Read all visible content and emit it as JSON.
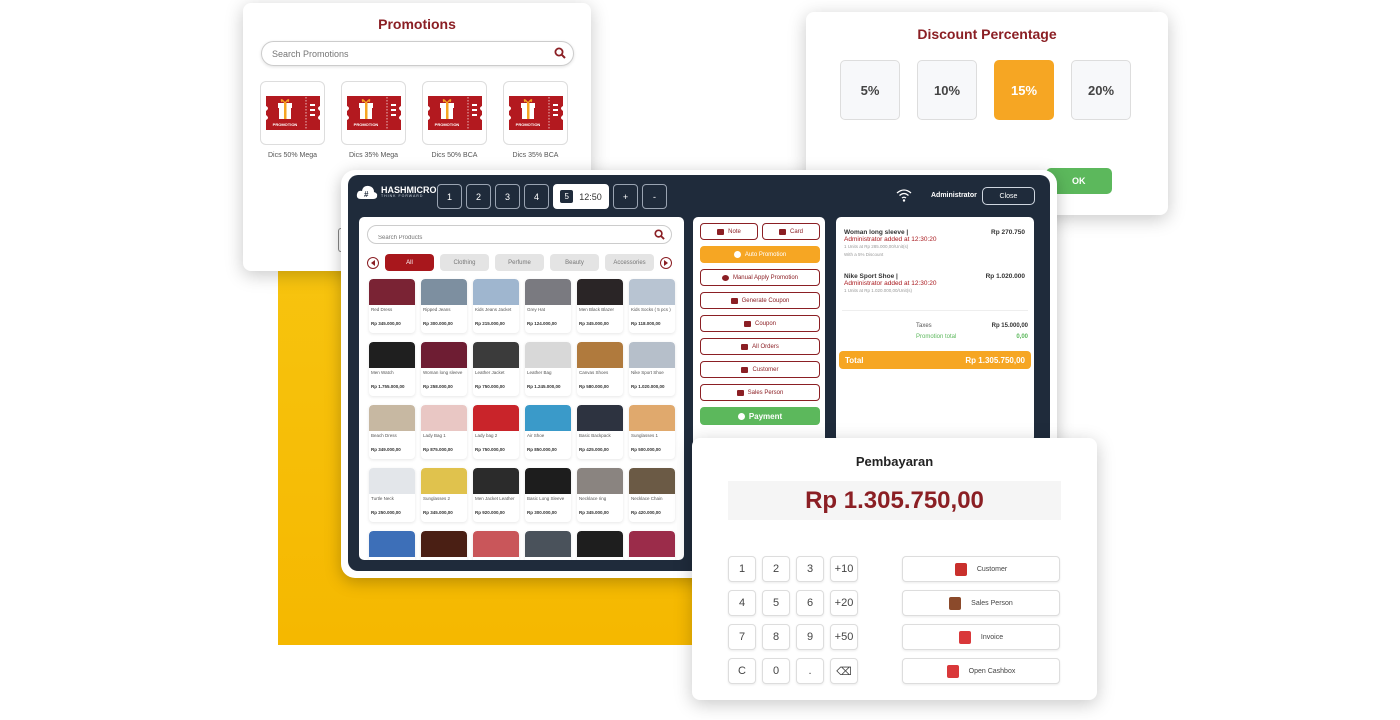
{
  "promotions": {
    "title": "Promotions",
    "search_placeholder": "Search Promotions",
    "items": [
      {
        "label": "Dics 50% Mega",
        "badge": "PROMOTION"
      },
      {
        "label": "Dics 35% Mega",
        "badge": "PROMOTION"
      },
      {
        "label": "Dics 50% BCA",
        "badge": "PROMOTION"
      },
      {
        "label": "Dics 35% BCA",
        "badge": "PROMOTION"
      }
    ]
  },
  "discount": {
    "title": "Discount Percentage",
    "options": [
      "5%",
      "10%",
      "15%",
      "20%"
    ],
    "selected": "15%",
    "ok_label": "OK"
  },
  "pos": {
    "brand": "HASHMICRO",
    "brand_tagline": "THINK FORWARD",
    "tabs": [
      "1",
      "2",
      "3",
      "4"
    ],
    "active_tab": {
      "number": "5",
      "time": "12:50"
    },
    "add_tab": "+",
    "remove_tab": "-",
    "user": "Administrator",
    "close_label": "Close",
    "search_placeholder": "Search Products",
    "categories": [
      "All",
      "Clothing",
      "Perfume",
      "Beauty",
      "Accessories"
    ],
    "active_category": "All",
    "products": [
      {
        "name": "Red Dress",
        "price": "Rp 345.000,00",
        "color": "#7a2334"
      },
      {
        "name": "Ripped Jeans",
        "price": "Rp 300.000,00",
        "color": "#7d8fa0"
      },
      {
        "name": "Kids Jeans Jacket",
        "price": "Rp 215.000,00",
        "color": "#9fb6cf"
      },
      {
        "name": "Grey Hat",
        "price": "Rp 124.000,00",
        "color": "#7a7a80"
      },
      {
        "name": "Men Black Blazer",
        "price": "Rp 345.000,00",
        "color": "#2a2526"
      },
      {
        "name": "Kids Socks ( 5 pcs )",
        "price": "Rp 118.000,00",
        "color": "#b8c4d2"
      },
      {
        "name": "Men Watch",
        "price": "Rp 1.755.000,00",
        "color": "#1f1f1f"
      },
      {
        "name": "Woman long sleeve",
        "price": "Rp 258.000,00",
        "color": "#6e1d33"
      },
      {
        "name": "Leather Jacket",
        "price": "Rp 750.000,00",
        "color": "#3b3b3b"
      },
      {
        "name": "Leather Bag",
        "price": "Rp 1.245.000,00",
        "color": "#d8d8d8"
      },
      {
        "name": "Canvas Shoes",
        "price": "Rp 580.000,00",
        "color": "#b07a3d"
      },
      {
        "name": "Nike Sport Shoe",
        "price": "Rp 1.020.000,00",
        "color": "#b6bfca"
      },
      {
        "name": "Beach Dress",
        "price": "Rp 349.000,00",
        "color": "#c7b8a2"
      },
      {
        "name": "Lady Bag 1",
        "price": "Rp 875.000,00",
        "color": "#e9c7c4"
      },
      {
        "name": "Lady bag 2",
        "price": "Rp 750.000,00",
        "color": "#c9242a"
      },
      {
        "name": "Air Shoe",
        "price": "Rp 850.000,00",
        "color": "#3a9ac9"
      },
      {
        "name": "Basic Backpack",
        "price": "Rp 425.000,00",
        "color": "#2d3340"
      },
      {
        "name": "Sunglasses 1",
        "price": "Rp 500.000,00",
        "color": "#e0a96d"
      },
      {
        "name": "Turtle Neck",
        "price": "Rp 250.000,00",
        "color": "#e3e6ea"
      },
      {
        "name": "Sunglasses 2",
        "price": "Rp 345.000,00",
        "color": "#e0c24d"
      },
      {
        "name": "Men Jacket Leather",
        "price": "Rp 920.000,00",
        "color": "#2b2b2b"
      },
      {
        "name": "Basic Long Sleeve",
        "price": "Rp 300.000,00",
        "color": "#1d1d1d"
      },
      {
        "name": "Necklace ring",
        "price": "Rp 345.000,00",
        "color": "#8a8480"
      },
      {
        "name": "Necklace Chain",
        "price": "Rp 420.000,00",
        "color": "#6b5a45"
      },
      {
        "name": "",
        "price": "",
        "color": "#3d6fb8"
      },
      {
        "name": "",
        "price": "",
        "color": "#4a1f14"
      },
      {
        "name": "",
        "price": "",
        "color": "#c9565a"
      },
      {
        "name": "",
        "price": "",
        "color": "#4a525b"
      },
      {
        "name": "",
        "price": "",
        "color": "#1e1e1e"
      },
      {
        "name": "",
        "price": "",
        "color": "#9b2c4a"
      }
    ],
    "actions": {
      "note": "Note",
      "card": "Card",
      "auto_promotion": "Auto Promotion",
      "manual_promotion": "Manual Apply Promotion",
      "generate_coupon": "Generate Coupon",
      "coupon": "Coupon",
      "all_orders": "All Orders",
      "customer": "Customer",
      "sales_person": "Sales Person",
      "payment": "Payment"
    },
    "order_lines": [
      {
        "name": "Woman long sleeve |",
        "amount": "Rp 270.750",
        "added_by": "Administrator added at 12:30:20",
        "detail": "1 Units at Rp 285.000,00/Unit(s)",
        "note": "With a 5% Discount"
      },
      {
        "name": "Nike Sport Shoe |",
        "amount": "Rp 1.020.000",
        "added_by": "Administrator added at 12:30:20",
        "detail": "1 Units at Rp 1.020.000,00/Unit(s)",
        "note": ""
      }
    ],
    "taxes_label": "Taxes",
    "taxes_value": "Rp 15.000,00",
    "promotion_total_label": "Promotion total",
    "promotion_total_value": "0,00",
    "total_label": "Total",
    "total_value": "Rp 1.305.750,00"
  },
  "payment": {
    "title": "Pembayaran",
    "amount": "Rp 1.305.750,00",
    "keys": [
      "1",
      "2",
      "3",
      "+10",
      "4",
      "5",
      "6",
      "+20",
      "7",
      "8",
      "9",
      "+50",
      "C",
      "0",
      ".",
      "⌫"
    ],
    "actions": [
      {
        "label": "Customer",
        "icon": "customer-icon",
        "color": "#c9302c"
      },
      {
        "label": "Sales Person",
        "icon": "sales-person-icon",
        "color": "#8b4a2b"
      },
      {
        "label": "Invoice",
        "icon": "invoice-icon",
        "color": "#d9383a"
      },
      {
        "label": "Open Cashbox",
        "icon": "cashbox-icon",
        "color": "#d9383a"
      }
    ]
  },
  "colors": {
    "brand_red": "#8b1f24",
    "accent_orange": "#f6a623",
    "success_green": "#5cb85c",
    "pos_dark": "#1f2b3b",
    "background_yellow": "#f7c40f"
  }
}
